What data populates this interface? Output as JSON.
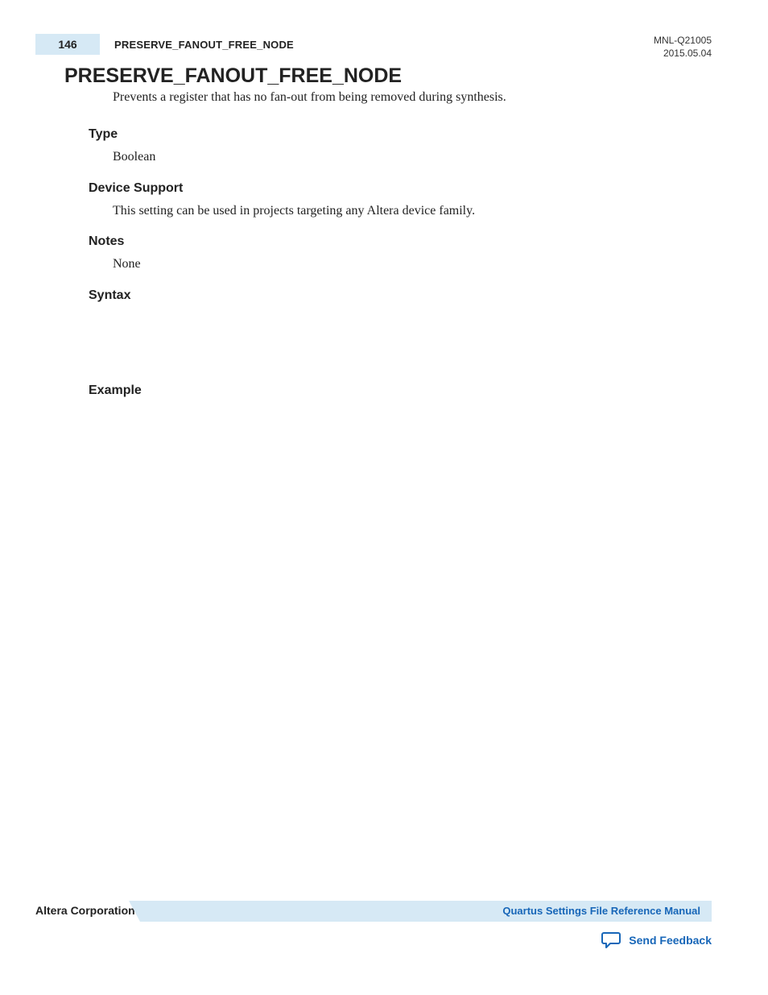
{
  "header": {
    "page_number": "146",
    "running_title": "PRESERVE_FANOUT_FREE_NODE",
    "doc_id": "MNL-Q21005",
    "date": "2015.05.04"
  },
  "title": "PRESERVE_FANOUT_FREE_NODE",
  "description": "Prevents a register that has no fan-out from being removed during synthesis.",
  "sections": {
    "type": {
      "heading": "Type",
      "body": "Boolean"
    },
    "device_support": {
      "heading": "Device Support",
      "body": "This setting can be used in projects targeting any Altera device family."
    },
    "notes": {
      "heading": "Notes",
      "body": "None"
    },
    "syntax": {
      "heading": "Syntax",
      "body": ""
    },
    "example": {
      "heading": "Example",
      "body": ""
    }
  },
  "footer": {
    "company": "Altera Corporation",
    "manual_link": "Quartus Settings File Reference Manual",
    "feedback_label": "Send Feedback"
  }
}
